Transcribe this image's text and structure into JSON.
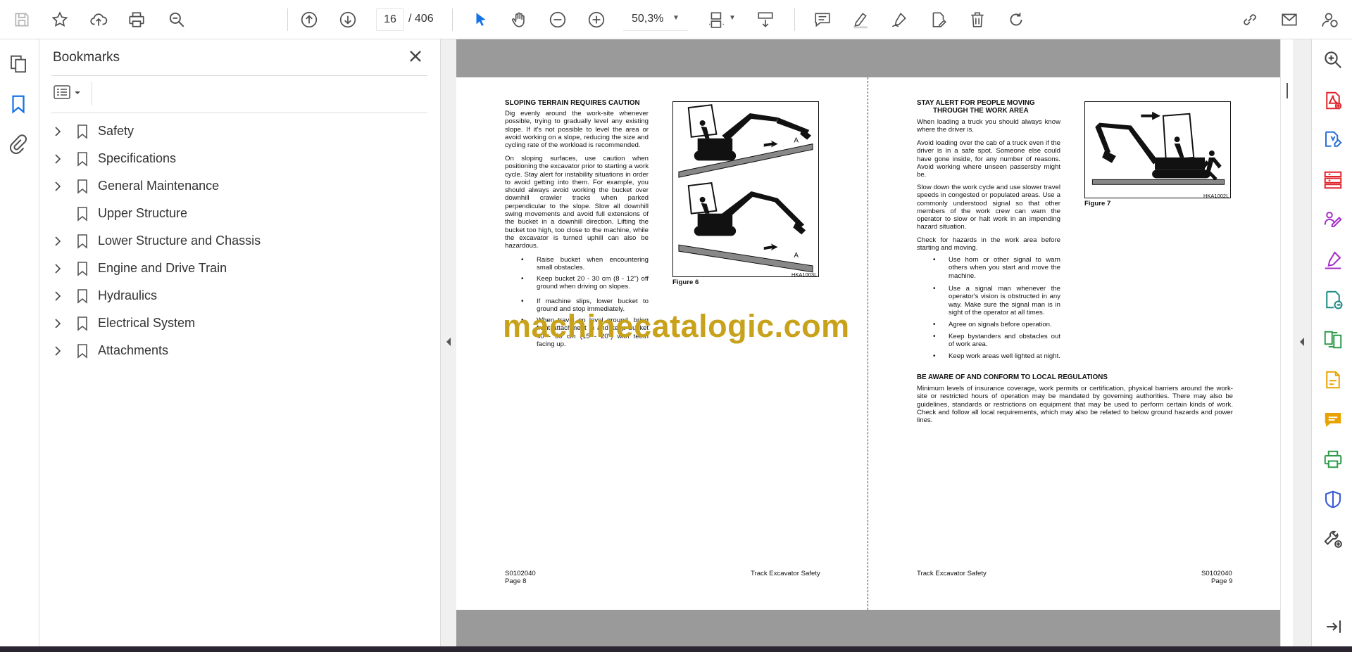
{
  "toolbar": {
    "current_page": "16",
    "total_pages": "/ 406",
    "zoom": "50,3%"
  },
  "panel": {
    "title": "Bookmarks"
  },
  "bookmarks": [
    {
      "label": "Safety",
      "expandable": true
    },
    {
      "label": "Specifications",
      "expandable": true
    },
    {
      "label": "General Maintenance",
      "expandable": true
    },
    {
      "label": "Upper Structure",
      "expandable": false
    },
    {
      "label": "Lower Structure and Chassis",
      "expandable": true
    },
    {
      "label": "Engine and Drive Train",
      "expandable": true
    },
    {
      "label": "Hydraulics",
      "expandable": true
    },
    {
      "label": "Electrical System",
      "expandable": true
    },
    {
      "label": "Attachments",
      "expandable": true
    }
  ],
  "page_left": {
    "heading": "SLOPING TERRAIN REQUIRES CAUTION",
    "para1": "Dig evenly around the work-site whenever possible, trying to gradually level any existing slope. If it's not possible to level the area or avoid working on a slope, reducing the size and cycling rate of the workload is recommended.",
    "para2": "On sloping surfaces, use caution when positioning the excavator prior to starting a work cycle. Stay alert for instability situations in order to avoid getting into them. For example, you should always avoid working the bucket over downhill crawler tracks when parked perpendicular to the slope. Slow all downhill swing movements and avoid full extensions of the bucket in a downhill direction. Lifting the bucket too high, too close to the machine, while the excavator is turned uphill can also be hazardous.",
    "bullets": [
      "Raise bucket when encountering small obstacles.",
      "Keep bucket 20 - 30 cm (8 - 12\") off ground when driving on slopes.",
      "If machine slips, lower bucket to ground and stop immediately.",
      "When travel on level ground, bring front attachment in and keep bucket 40 - 50 cm (15 - 20\") with teeth facing up."
    ],
    "figure_caption": "Figure 6",
    "figure_id": "HKA1003L",
    "figure_mark": "A",
    "footer_code": "S0102040",
    "footer_page": "Page 8",
    "footer_title": "Track Excavator Safety"
  },
  "page_right": {
    "heading_line1": "STAY ALERT FOR PEOPLE MOVING",
    "heading_line2": "THROUGH THE WORK AREA",
    "para1": "When loading a truck you should always know where the driver is.",
    "para2": "Avoid loading over the cab of a truck even if the driver is in a safe spot. Someone else could have gone inside, for any number of reasons. Avoid working where unseen passersby might be.",
    "para3": "Slow down the work cycle and use slower travel speeds in congested or populated areas. Use a commonly understood signal so that other members of the work crew can warn the operator to slow or halt work in an impending hazard situation.",
    "para4": "Check for hazards in the work area before starting and moving.",
    "bullets": [
      "Use horn or other signal to warn others when you start and move the machine.",
      "Use a signal man whenever the operator's vision is obstructed in any way. Make sure the signal man is in sight of the operator at all times.",
      "Agree on signals before operation.",
      "Keep bystanders and obstacles out of work area.",
      "Keep work areas well lighted at night."
    ],
    "heading2": "BE AWARE OF AND CONFORM TO LOCAL REGULATIONS",
    "para5": "Minimum levels of insurance coverage, work permits or certification, physical barriers around the work-site or restricted hours of operation may be mandated by governing authorities. There may also be guidelines, standards or restrictions on equipment that may be used to perform certain kinds of work. Check and follow all local requirements, which may also be related to below ground hazards and power lines.",
    "figure_caption": "Figure 7",
    "figure_id": "HKA1002L",
    "footer_title": "Track Excavator Safety",
    "footer_code": "S0102040",
    "footer_page": "Page 9"
  },
  "watermark": "machinecatalogic.com",
  "colors": {
    "accent_blue": "#1473e6",
    "watermark": "#c9a21c",
    "doc_background": "#9a9a9a"
  }
}
